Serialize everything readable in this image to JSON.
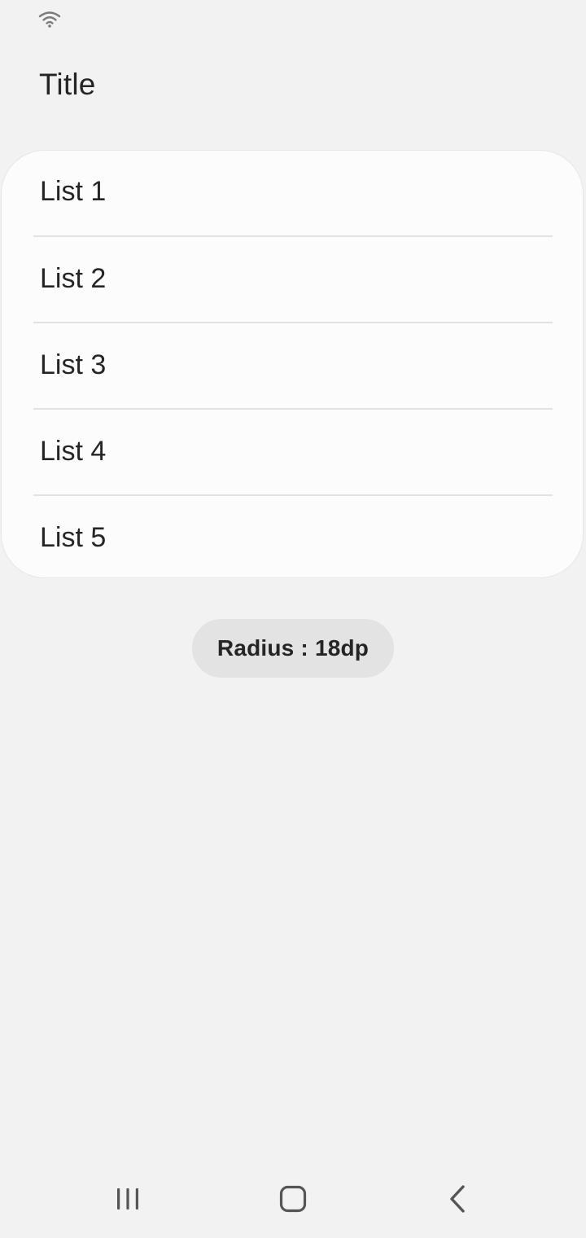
{
  "status_bar": {
    "icons": [
      "wifi-icon"
    ]
  },
  "header": {
    "title": "Title"
  },
  "list": {
    "items": [
      {
        "label": "List 1"
      },
      {
        "label": "List 2"
      },
      {
        "label": "List 3"
      },
      {
        "label": "List 4"
      },
      {
        "label": "List 5"
      }
    ]
  },
  "chip": {
    "label": "Radius : 18dp"
  },
  "nav_bar": {
    "buttons": [
      "recents-icon",
      "home-icon",
      "back-icon"
    ]
  },
  "colors": {
    "background": "#f2f2f2",
    "card": "#fcfcfc",
    "divider": "#e2e2e2",
    "chip": "#e3e3e3",
    "text": "#252525",
    "icon": "#555555"
  }
}
